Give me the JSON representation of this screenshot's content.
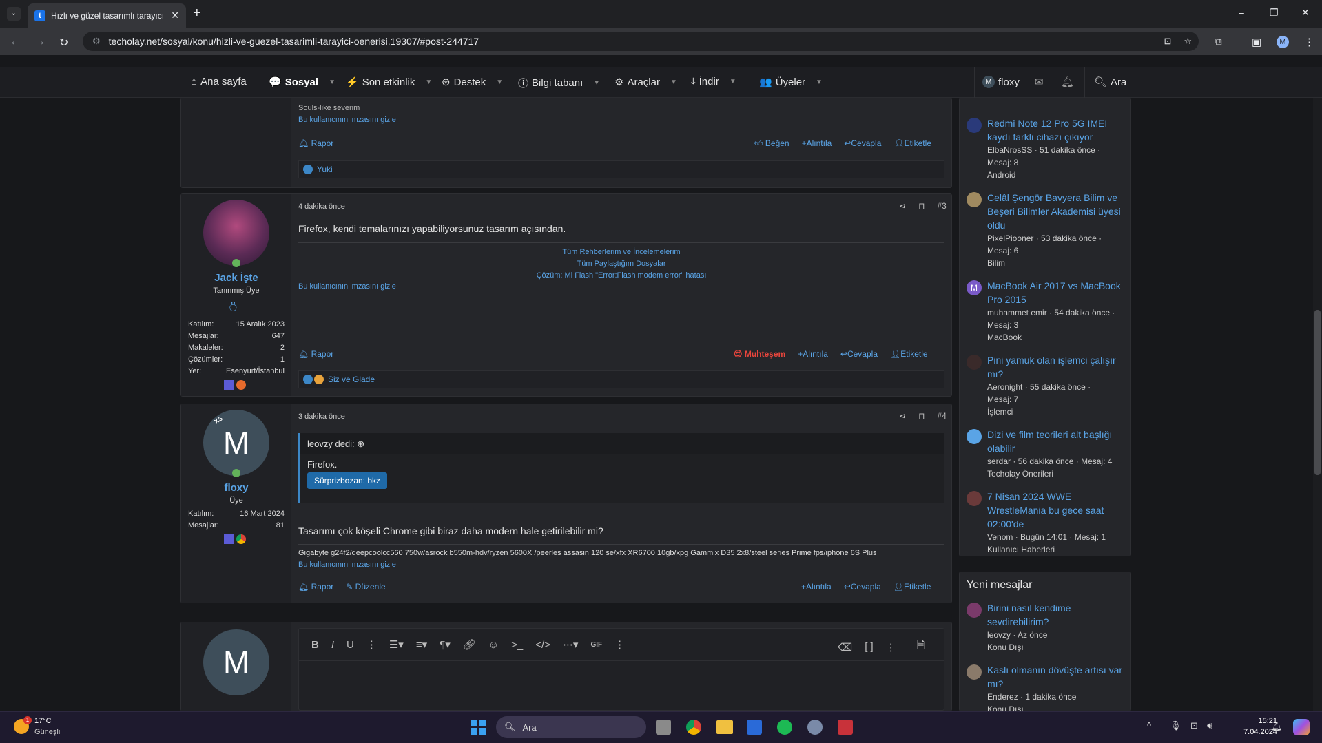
{
  "browser": {
    "tab_title": "Hızlı ve güzel tasarımlı tarayıcı ö",
    "tab_favicon": "t",
    "url": "techolay.net/sosyal/konu/hizli-ve-guezel-tasarimli-tarayici-oenerisi.19307/#post-244717",
    "profile_initial": "M"
  },
  "nav": {
    "home": "Ana sayfa",
    "social": "Sosyal",
    "activity": "Son etkinlik",
    "support": "Destek",
    "kb": "Bilgi tabanı",
    "tools": "Araçlar",
    "download": "İndir",
    "members": "Üyeler",
    "user": "floxy",
    "user_initial": "M",
    "search": "Ara"
  },
  "post2_tail": {
    "sig_line": "Souls-like severim",
    "hide_sig": "Bu kullanıcının imzasını gizle",
    "report": "Rapor",
    "like": "Beğen",
    "quote": "Alıntıla",
    "reply": "Cevapla",
    "tag": "Etiketle",
    "reactions": "Yuki"
  },
  "post3": {
    "time": "4 dakika önce",
    "number": "#3",
    "body": "Firefox, kendi temalarınızı yapabiliyorsunuz tasarım açısından.",
    "sig_links": [
      "Tüm Rehberlerim ve İncelemelerim",
      "Tüm Paylaştığım Dosyalar",
      "Çözüm: Mi Flash \"Error:Flash modem error\" hatası"
    ],
    "hide_sig": "Bu kullanıcının imzasını gizle",
    "report": "Rapor",
    "reaction_label": "Muhteşem",
    "quote": "Alıntıla",
    "reply": "Cevapla",
    "tag": "Etiketle",
    "reactions": "Siz ve Glade",
    "author": {
      "name": "Jack İşte",
      "title": "Tanınmış Üye",
      "stats": [
        {
          "k": "Katılım:",
          "v": "15 Aralık 2023"
        },
        {
          "k": "Mesajlar:",
          "v": "647"
        },
        {
          "k": "Makaleler:",
          "v": "2"
        },
        {
          "k": "Çözümler:",
          "v": "1"
        },
        {
          "k": "Yer:",
          "v": "Esenyurt/İstanbul"
        }
      ]
    }
  },
  "post4": {
    "time": "3 dakika önce",
    "number": "#4",
    "quote_author": "leovzy dedi:",
    "quote_text": "Firefox.",
    "spoiler": "Sürprizbozan: bkz",
    "body": "Tasarımı çok köşeli Chrome gibi biraz daha modern hale getirilebilir mi?",
    "signature": "Gigabyte g24f2/deepcoolcc560 750w/asrock b550m-hdv/ryzen 5600X /peerles assasin 120 se/xfx XR6700 10gb/xpg Gammix D35 2x8/steel series Prime fps/iphone 6S Plus",
    "hide_sig": "Bu kullanıcının imzasını gizle",
    "report": "Rapor",
    "edit": "Düzenle",
    "quote": "Alıntıla",
    "reply": "Cevapla",
    "tag": "Etiketle",
    "author": {
      "initial": "M",
      "badge": "XS",
      "name": "floxy",
      "title": "Üye",
      "stats": [
        {
          "k": "Katılım:",
          "v": "16 Mart 2024"
        },
        {
          "k": "Mesajlar:",
          "v": "81"
        }
      ]
    }
  },
  "editor": {
    "avatar_initial": "M"
  },
  "sidebar_threads": [
    {
      "title": "Redmi Note 12 Pro 5G IMEI kaydı farklı cihazı çıkıyor",
      "meta": "ElbaNrosSS · 51 dakika önce ·",
      "meta2": "Mesaj: 8",
      "forum": "Android"
    },
    {
      "title": "Celâl Şengör Bavyera Bilim ve Beşeri Bilimler Akademisi üyesi oldu",
      "meta": "PixelPiooner · 53 dakika önce ·",
      "meta2": "Mesaj: 6",
      "forum": "Bilim"
    },
    {
      "title": "MacBook Air 2017 vs MacBook Pro 2015",
      "meta": "muhammet emir · 54 dakika önce ·",
      "meta2": "Mesaj: 3",
      "forum": "MacBook"
    },
    {
      "title": "Pini yamuk olan işlemci çalışır mı?",
      "meta": "Aeronight · 55 dakika önce ·",
      "meta2": "Mesaj: 7",
      "forum": "İşlemci"
    },
    {
      "title": "Dizi ve film teorileri alt başlığı olabilir",
      "meta": "serdar · 56 dakika önce · Mesaj: 4",
      "meta2": "",
      "forum": "Techolay Önerileri"
    },
    {
      "title": "7 Nisan 2024 WWE WrestleMania bu gece saat 02:00'de",
      "meta": "Venom · Bugün 14:01 · Mesaj: 1",
      "meta2": "",
      "forum": "Kullanıcı Haberleri"
    }
  ],
  "new_messages": {
    "heading": "Yeni mesajlar",
    "items": [
      {
        "title": "Birini nasıl kendime sevdirebilirim?",
        "meta": "leovzy · Az önce",
        "forum": "Konu Dışı"
      },
      {
        "title": "Kaslı olmanın dövüşte artısı var mı?",
        "meta": "Enderez · 1 dakika önce",
        "forum": "Konu Dışı"
      }
    ]
  },
  "taskbar": {
    "weather_temp": "17°C",
    "weather_desc": "Güneşli",
    "search": "Ara",
    "time": "15:21",
    "date": "7.04.2024",
    "weather_badge": "1"
  },
  "colors": {
    "accent": "#5aa4e6",
    "reaction": "#e8453c",
    "bg": "#17181b"
  }
}
